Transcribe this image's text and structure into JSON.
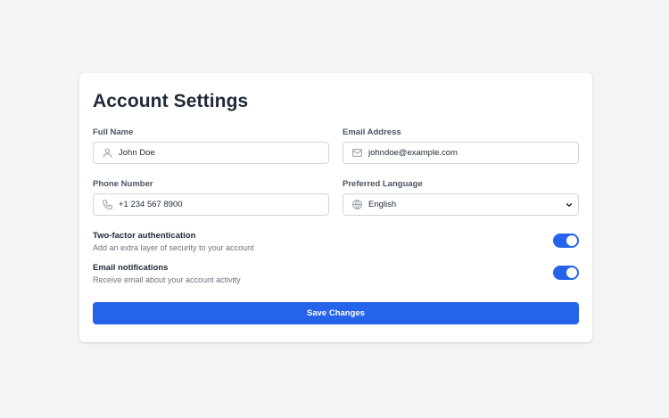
{
  "card": {
    "title": "Account Settings"
  },
  "fields": {
    "full_name": {
      "label": "Full Name",
      "value": "John Doe",
      "icon": "user-icon"
    },
    "email": {
      "label": "Email Address",
      "value": "johndoe@example.com",
      "icon": "mail-icon"
    },
    "phone": {
      "label": "Phone Number",
      "value": "+1 234 567 8900",
      "icon": "phone-icon"
    },
    "language": {
      "label": "Preferred Language",
      "value": "English",
      "icon": "globe-icon"
    }
  },
  "toggles": {
    "two_factor": {
      "title": "Two-factor authentication",
      "description": "Add an extra layer of security to your account",
      "enabled": true
    },
    "email_notifications": {
      "title": "Email notifications",
      "description": "Receive email about your account activity",
      "enabled": true
    }
  },
  "actions": {
    "save_label": "Save Changes"
  },
  "colors": {
    "accent": "#2563eb",
    "background": "#f3f4f6",
    "card": "#ffffff"
  }
}
